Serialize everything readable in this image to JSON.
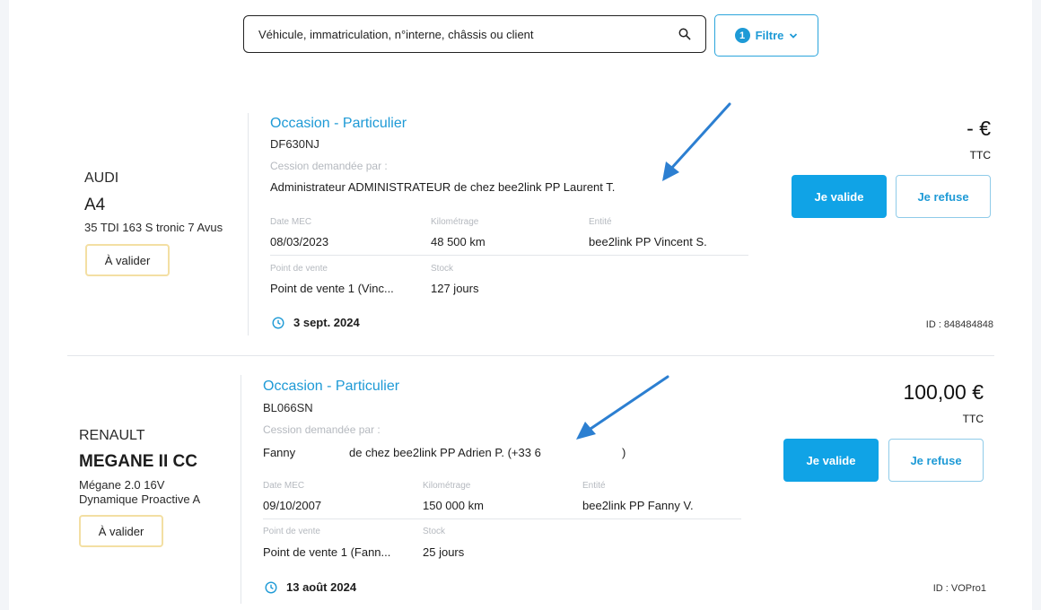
{
  "search": {
    "placeholder": "Véhicule, immatriculation, n°interne, châssis ou client"
  },
  "filter": {
    "count": "1",
    "label": "Filtre"
  },
  "colors": {
    "accent": "#1e9ad6",
    "button": "#10a3e6",
    "badge_border": "#f3dfa3",
    "arrow": "#2c7fd1"
  },
  "cards": [
    {
      "brand": "AUDI",
      "model": "A4",
      "version": "35 TDI 163 S tronic 7 Avus",
      "status": "À valider",
      "offer_type": "Occasion - Particulier",
      "plate": "DF630NJ",
      "requested_by_label": "Cession demandée par :",
      "requester": "Administrateur ADMINISTRATEUR de chez bee2link PP Laurent T.",
      "date_mec_label": "Date MEC",
      "date_mec": "08/03/2023",
      "km_label": "Kilométrage",
      "km": "48 500 km",
      "entity_label": "Entité",
      "entity": "bee2link PP Vincent S.",
      "pos_label": "Point de vente",
      "pos": "Point de vente 1 (Vinc...",
      "stock_label": "Stock",
      "stock": "127 jours",
      "date": "3 sept. 2024",
      "price": "- €",
      "ttc": "TTC",
      "validate_label": "Je valide",
      "refuse_label": "Je refuse",
      "id": "ID : 848484848"
    },
    {
      "brand": "RENAULT",
      "model": "MEGANE II CC",
      "version_line1": "Mégane 2.0 16V",
      "version_line2": "Dynamique Proactive A",
      "status": "À valider",
      "offer_type": "Occasion - Particulier",
      "plate": "BL066SN",
      "requested_by_label": "Cession demandée par :",
      "requester_first": "Fanny",
      "requester_rest": "de chez bee2link PP Adrien P. (+33 6",
      "requester_close": ")",
      "date_mec_label": "Date MEC",
      "date_mec": "09/10/2007",
      "km_label": "Kilométrage",
      "km": "150 000 km",
      "entity_label": "Entité",
      "entity": "bee2link PP Fanny V.",
      "pos_label": "Point de vente",
      "pos": "Point de vente 1 (Fann...",
      "stock_label": "Stock",
      "stock": "25 jours",
      "date": "13 août 2024",
      "price": "100,00 €",
      "ttc": "TTC",
      "validate_label": "Je valide",
      "refuse_label": "Je refuse",
      "id": "ID : VOPro1"
    }
  ]
}
